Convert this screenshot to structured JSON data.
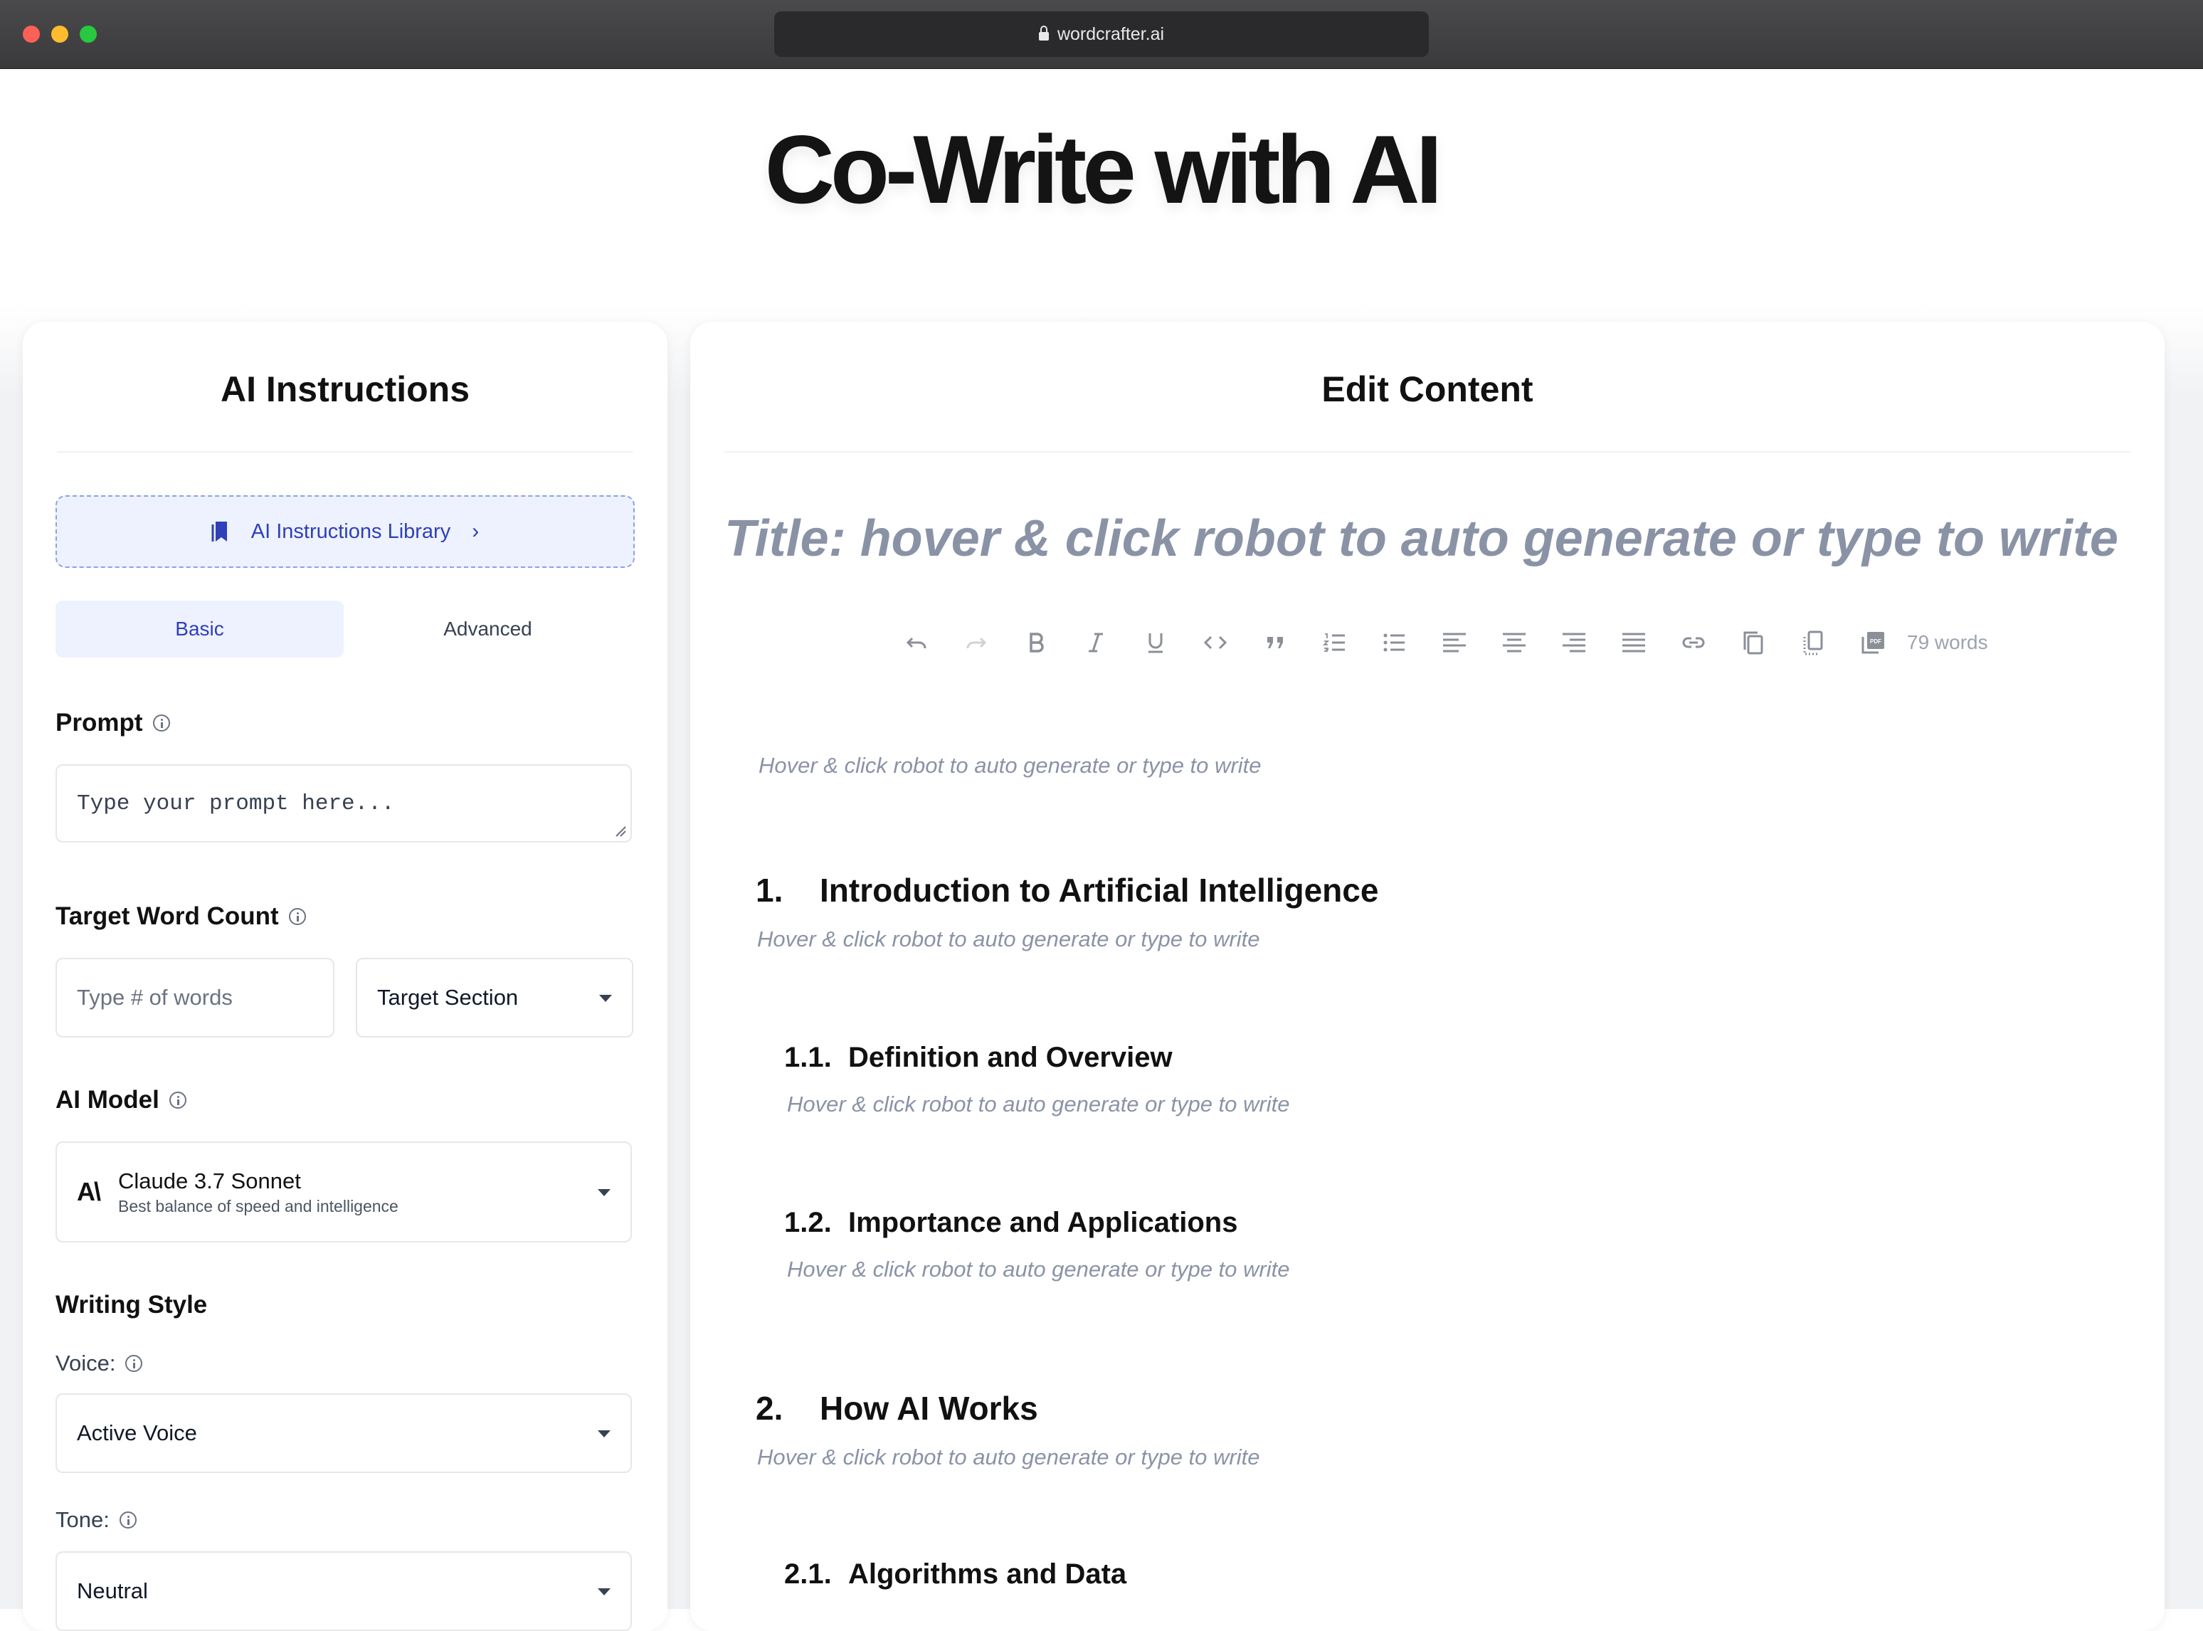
{
  "browser": {
    "url": "wordcrafter.ai"
  },
  "hero": {
    "title": "Co-Write with AI"
  },
  "left": {
    "title": "AI Instructions",
    "library_label": "AI Instructions Library",
    "tabs": [
      "Basic",
      "Advanced"
    ],
    "active_tab": "Basic",
    "prompt": {
      "label": "Prompt",
      "placeholder": "Type your prompt here..."
    },
    "word_count": {
      "label": "Target Word Count",
      "placeholder": "Type # of words",
      "section": "Target Section"
    },
    "model": {
      "label": "AI Model",
      "mark": "A\\",
      "name": "Claude 3.7 Sonnet",
      "desc": "Best balance of speed and intelligence"
    },
    "style": {
      "label": "Writing Style",
      "voice_label": "Voice:",
      "voice": "Active Voice",
      "tone_label": "Tone:",
      "tone": "Neutral"
    }
  },
  "right": {
    "title": "Edit Content",
    "doc_title_placeholder": "Title: hover & click robot to auto generate or type to write",
    "word_count": "79 words",
    "hint": "Hover & click robot to auto generate or type to write",
    "sections": [
      {
        "num": "1.",
        "title": "Introduction to Artificial Intelligence"
      },
      {
        "num": "1.1.",
        "title": "Definition and Overview"
      },
      {
        "num": "1.2.",
        "title": "Importance and Applications"
      },
      {
        "num": "2.",
        "title": "How AI Works"
      },
      {
        "num": "2.1.",
        "title": "Algorithms and Data"
      }
    ]
  },
  "toolbar": [
    {
      "icon": "undo-icon",
      "enabled": true
    },
    {
      "icon": "redo-icon",
      "enabled": false
    },
    {
      "icon": "bold-icon",
      "enabled": true
    },
    {
      "icon": "italic-icon",
      "enabled": true
    },
    {
      "icon": "underline-icon",
      "enabled": true
    },
    {
      "icon": "code-icon",
      "enabled": true
    },
    {
      "icon": "quote-icon",
      "enabled": true
    },
    {
      "icon": "ordered-list-icon",
      "enabled": true
    },
    {
      "icon": "bullet-list-icon",
      "enabled": true
    },
    {
      "icon": "align-left-icon",
      "enabled": true
    },
    {
      "icon": "align-center-icon",
      "enabled": true
    },
    {
      "icon": "align-right-icon",
      "enabled": true
    },
    {
      "icon": "align-justify-icon",
      "enabled": true
    },
    {
      "icon": "link-icon",
      "enabled": true
    },
    {
      "icon": "copy-icon",
      "enabled": true
    },
    {
      "icon": "copy-selection-icon",
      "enabled": true
    },
    {
      "icon": "pdf-icon",
      "enabled": true
    }
  ]
}
